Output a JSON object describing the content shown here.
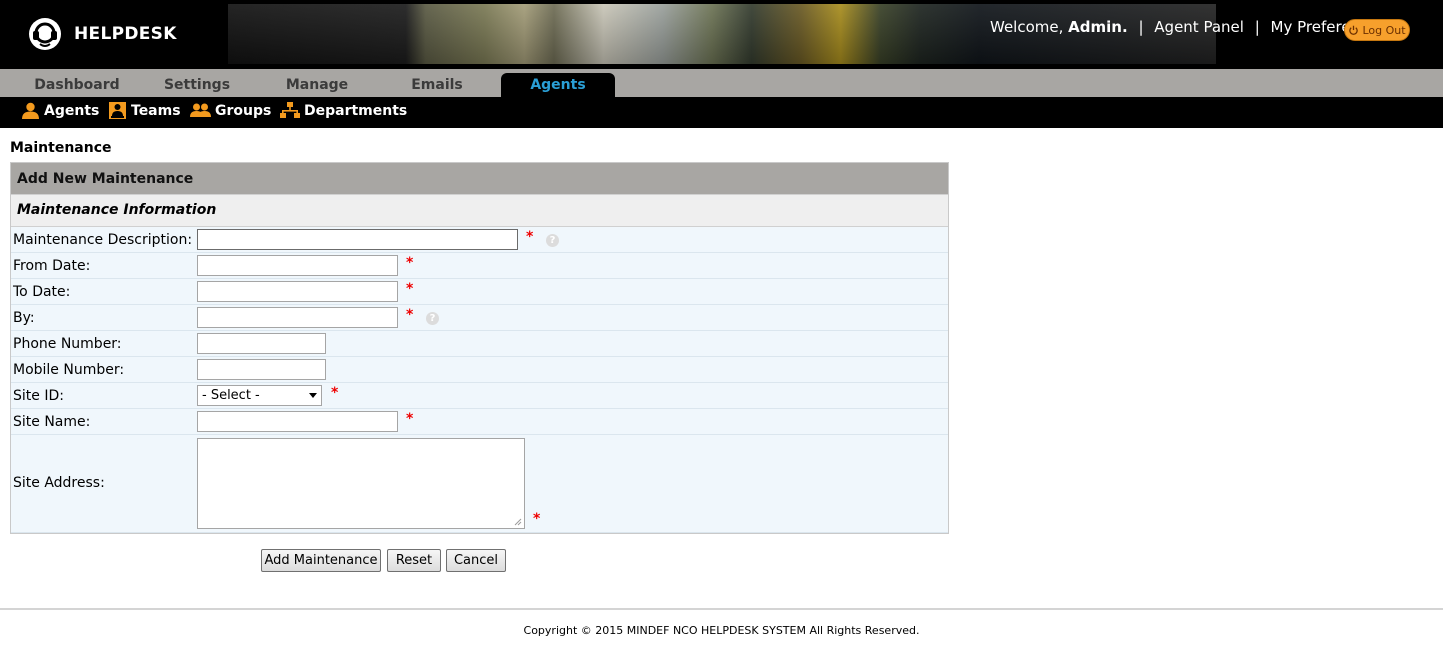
{
  "app": {
    "name": "HELPDESK"
  },
  "userbar": {
    "welcome_prefix": "Welcome, ",
    "username": "Admin.",
    "separator": "|",
    "agent_panel": "Agent Panel",
    "my_preferences": "My Preferences",
    "logout": "Log Out"
  },
  "tabs": [
    {
      "label": "Dashboard"
    },
    {
      "label": "Settings"
    },
    {
      "label": "Manage"
    },
    {
      "label": "Emails"
    },
    {
      "label": "Agents",
      "active": true
    }
  ],
  "subnav": [
    {
      "label": "Agents",
      "icon": "agent-icon"
    },
    {
      "label": "Teams",
      "icon": "team-icon"
    },
    {
      "label": "Groups",
      "icon": "groups-icon"
    },
    {
      "label": "Departments",
      "icon": "departments-icon"
    }
  ],
  "page": {
    "title": "Maintenance"
  },
  "form": {
    "header": "Add New Maintenance",
    "section": "Maintenance Information",
    "fields": {
      "description": {
        "label": "Maintenance Description:",
        "value": ""
      },
      "from_date": {
        "label": "From Date:",
        "value": ""
      },
      "to_date": {
        "label": "To Date:",
        "value": ""
      },
      "by": {
        "label": "By:",
        "value": ""
      },
      "phone": {
        "label": "Phone Number:",
        "value": ""
      },
      "mobile": {
        "label": "Mobile Number:",
        "value": ""
      },
      "site_id": {
        "label": "Site ID:",
        "selected": "- Select -"
      },
      "site_name": {
        "label": "Site Name:",
        "value": ""
      },
      "site_address": {
        "label": "Site Address:",
        "value": ""
      }
    },
    "required_mark": "*",
    "help_mark": "?",
    "buttons": {
      "add": "Add Maintenance",
      "reset": "Reset",
      "cancel": "Cancel"
    }
  },
  "footer": {
    "copyright": "Copyright © 2015 MINDEF NCO HELPDESK SYSTEM All Rights Reserved."
  },
  "colors": {
    "accent": "#2a9fd6",
    "logout": "#f7a02c",
    "required": "#e00000",
    "icon_orange": "#f39a1e"
  }
}
